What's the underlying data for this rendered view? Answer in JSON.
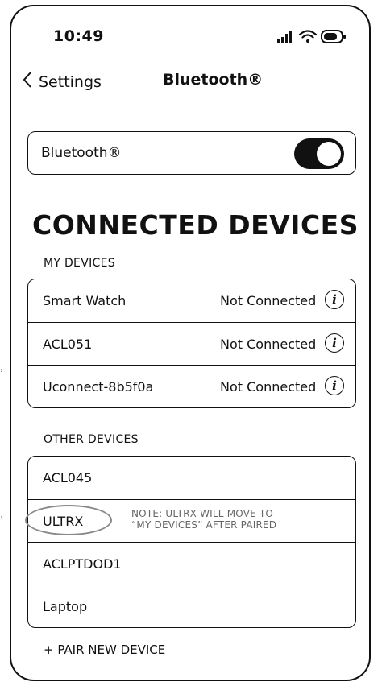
{
  "status_bar": {
    "time": "10:49"
  },
  "nav": {
    "back_label": "Settings",
    "title": "Bluetooth®"
  },
  "bluetooth_toggle": {
    "label": "Bluetooth®",
    "on": true
  },
  "section_heading": "CONNECTED DEVICES",
  "my_devices": {
    "header": "MY DEVICES",
    "items": [
      {
        "name": "Smart Watch",
        "status": "Not Connected"
      },
      {
        "name": "ACL051",
        "status": "Not Connected"
      },
      {
        "name": "Uconnect-8b5f0a",
        "status": "Not Connected"
      }
    ]
  },
  "other_devices": {
    "header": "OTHER DEVICES",
    "items": [
      {
        "name": "ACL045"
      },
      {
        "name": "ULTRX"
      },
      {
        "name": "ACLPTDOD1"
      },
      {
        "name": "Laptop"
      }
    ],
    "note_line1": "NOTE: ULTRX WILL MOVE TO",
    "note_line2": "“MY DEVICES” AFTER PAIRED"
  },
  "pair_new_label": "+ PAIR NEW DEVICE",
  "colors": {
    "accent": "#111111",
    "note": "#666666",
    "highlight_oval": "#888888"
  }
}
